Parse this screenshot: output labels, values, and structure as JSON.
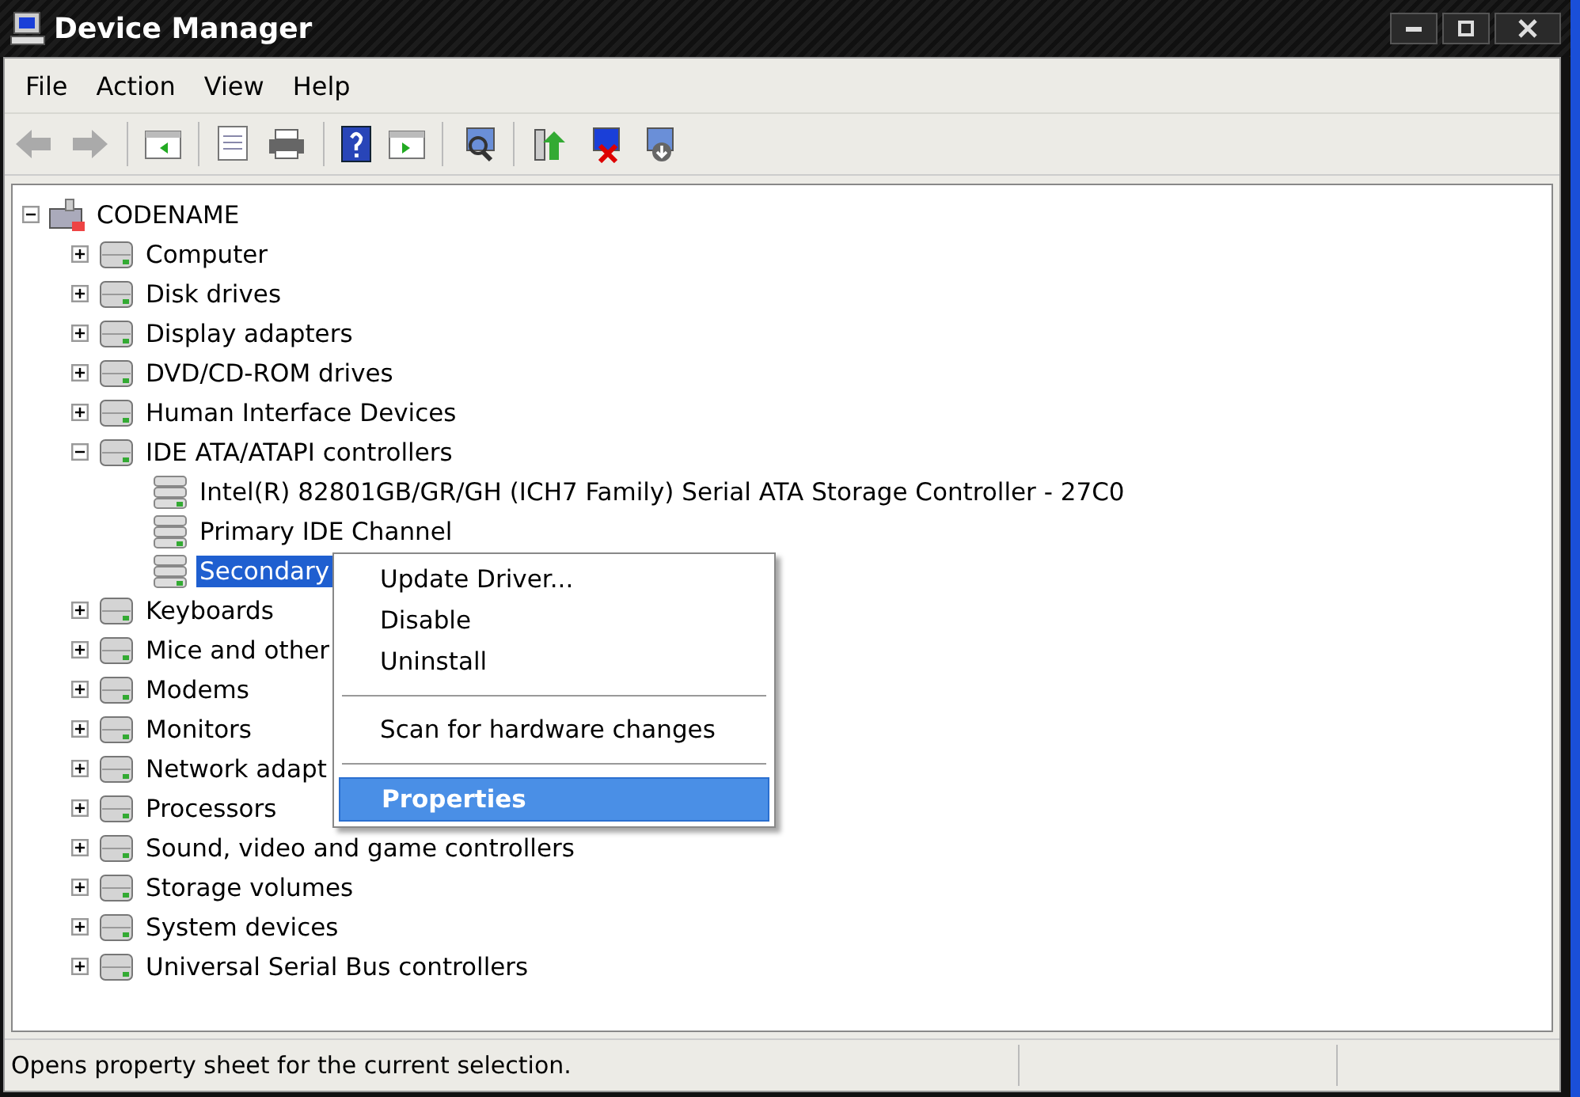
{
  "window": {
    "title": "Device Manager"
  },
  "menu_bar": [
    "File",
    "Action",
    "View",
    "Help"
  ],
  "tree": {
    "label": "CODENAME",
    "expanded": true,
    "selected": false,
    "children": [
      {
        "label": "Computer",
        "expanded": false,
        "selected": false
      },
      {
        "label": "Disk drives",
        "expanded": false,
        "selected": false
      },
      {
        "label": "Display adapters",
        "expanded": false,
        "selected": false
      },
      {
        "label": "DVD/CD-ROM drives",
        "expanded": false,
        "selected": false
      },
      {
        "label": "Human Interface Devices",
        "expanded": false,
        "selected": false
      },
      {
        "label": "IDE ATA/ATAPI controllers",
        "expanded": true,
        "selected": false,
        "children": [
          {
            "label": "Intel(R) 82801GB/GR/GH (ICH7 Family) Serial ATA Storage Controller - 27C0",
            "selected": false
          },
          {
            "label": "Primary IDE Channel",
            "selected": false
          },
          {
            "label": "Secondary",
            "selected": true
          }
        ]
      },
      {
        "label": "Keyboards",
        "expanded": false,
        "selected": false
      },
      {
        "label": "Mice and other",
        "expanded": false,
        "selected": false
      },
      {
        "label": "Modems",
        "expanded": false,
        "selected": false
      },
      {
        "label": "Monitors",
        "expanded": false,
        "selected": false
      },
      {
        "label": "Network adapt",
        "expanded": false,
        "selected": false
      },
      {
        "label": "Processors",
        "expanded": false,
        "selected": false
      },
      {
        "label": "Sound, video and game controllers",
        "expanded": false,
        "selected": false
      },
      {
        "label": "Storage volumes",
        "expanded": false,
        "selected": false
      },
      {
        "label": "System devices",
        "expanded": false,
        "selected": false
      },
      {
        "label": "Universal Serial Bus controllers",
        "expanded": false,
        "selected": false
      }
    ]
  },
  "context_menu": [
    {
      "kind": "item",
      "label": "Update Driver...",
      "selected": false
    },
    {
      "kind": "item",
      "label": "Disable",
      "selected": false
    },
    {
      "kind": "item",
      "label": "Uninstall",
      "selected": false
    },
    {
      "kind": "separator"
    },
    {
      "kind": "item",
      "label": "Scan for hardware changes",
      "selected": false
    },
    {
      "kind": "separator"
    },
    {
      "kind": "item",
      "label": "Properties",
      "selected": true
    }
  ],
  "status_bar": {
    "text": "Opens property sheet for the current selection."
  }
}
